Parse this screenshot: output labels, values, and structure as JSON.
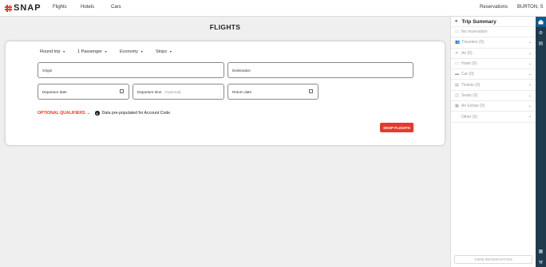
{
  "header": {
    "logo_text": "SNAP",
    "nav": {
      "flights": "Flights",
      "hotels": "Hotels",
      "cars": "Cars",
      "reservations": "Reservations",
      "user": "BURTON, S"
    }
  },
  "main": {
    "title": "FLIGHTS",
    "dropdowns": {
      "trip_type": "Round trip",
      "passengers": "1 Passenger",
      "cabin": "Economy",
      "stops": "Stops"
    },
    "fields": {
      "origin": "Origin",
      "destination": "Destination",
      "departure_date": "Departure date",
      "departure_time": "Departure time",
      "departure_time_hint": "(Optional)",
      "return_date": "Return date"
    },
    "qualifiers_label": "OPTIONAL QUALIFIERS",
    "info_text": "Data pre-populated for Account Code",
    "shop_button": "SHOP FLIGHTS"
  },
  "trip_summary": {
    "title": "Trip Summary",
    "no_reservation": "No reservation",
    "rows": [
      {
        "label": "Travelers (0)",
        "icon": "travelers-icon",
        "glyph": "👥"
      },
      {
        "label": "Air (0)",
        "icon": "plane-icon",
        "glyph": "✈"
      },
      {
        "label": "Hotel (0)",
        "icon": "hotel-icon",
        "glyph": "▭"
      },
      {
        "label": "Car (0)",
        "icon": "car-icon",
        "glyph": "▬"
      },
      {
        "label": "Tickets (0)",
        "icon": "ticket-icon",
        "glyph": "▤"
      },
      {
        "label": "Seats (0)",
        "icon": "seat-icon",
        "glyph": "◫"
      },
      {
        "label": "Air Extras (0)",
        "icon": "air-extras-icon",
        "glyph": "▦"
      },
      {
        "label": "Other (0)",
        "icon": "",
        "glyph": ""
      }
    ],
    "view_button": "VIEW RESERVATION"
  },
  "colors": {
    "accent": "#e53a2b",
    "rail": "#1f3a4d",
    "rail_active": "#0e5c8c"
  }
}
